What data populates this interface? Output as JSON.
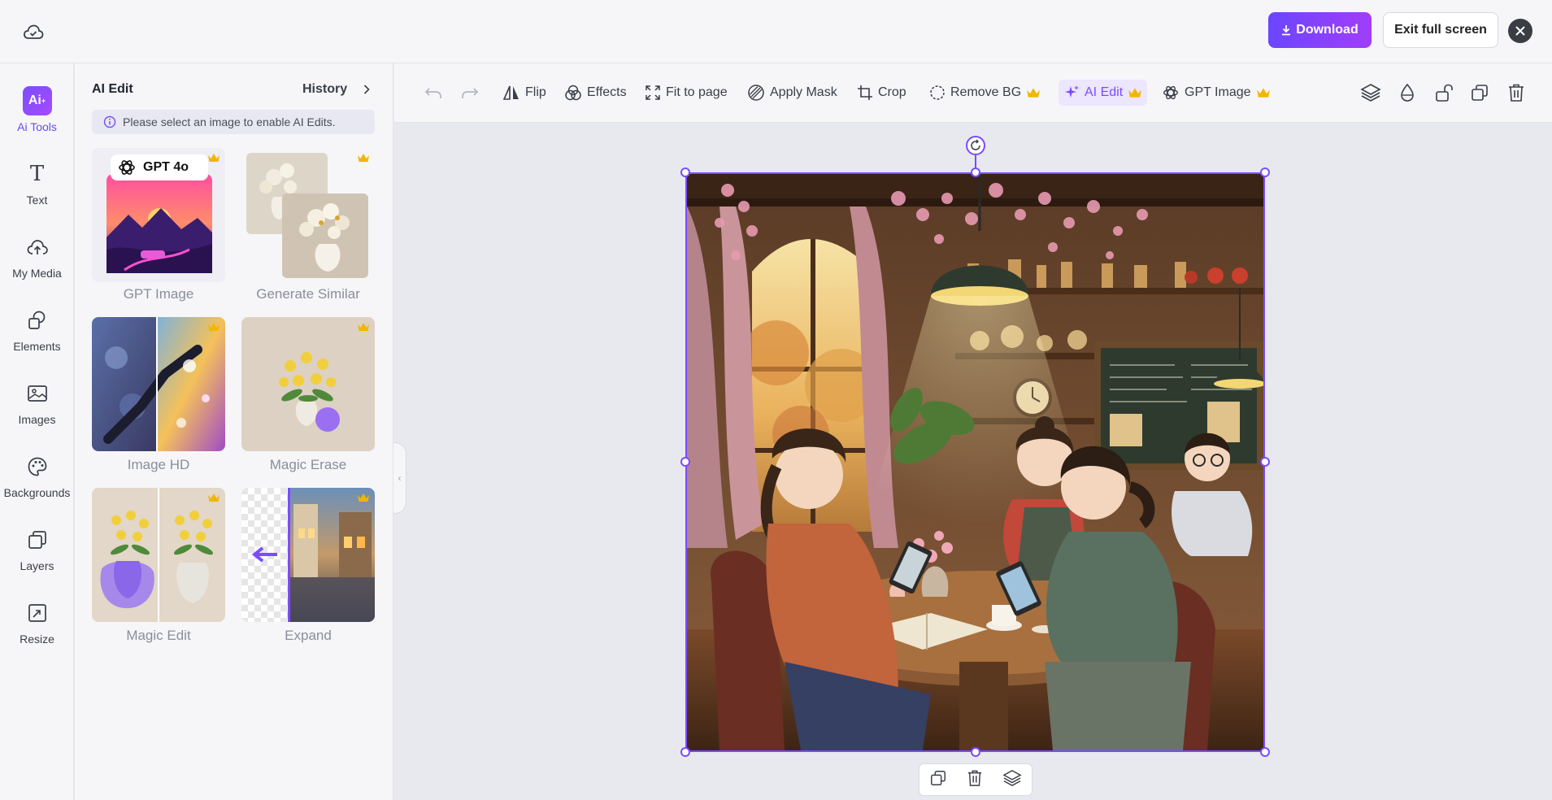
{
  "topbar": {
    "download_label": "Download",
    "exit_label": "Exit full screen"
  },
  "rail": {
    "items": [
      {
        "label": "Ai Tools",
        "icon": "ai-tools-icon"
      },
      {
        "label": "Text",
        "icon": "text-icon"
      },
      {
        "label": "My Media",
        "icon": "upload-cloud-icon"
      },
      {
        "label": "Elements",
        "icon": "elements-icon"
      },
      {
        "label": "Images",
        "icon": "image-icon"
      },
      {
        "label": "Backgrounds",
        "icon": "palette-icon"
      },
      {
        "label": "Layers",
        "icon": "layers-icon"
      },
      {
        "label": "Resize",
        "icon": "resize-icon"
      }
    ]
  },
  "panel": {
    "title": "AI Edit",
    "history_label": "History",
    "notice": "Please select an image to enable AI Edits.",
    "tools": [
      {
        "label": "GPT Image",
        "badge": "GPT 4o"
      },
      {
        "label": "Generate Similar"
      },
      {
        "label": "Image HD"
      },
      {
        "label": "Magic Erase"
      },
      {
        "label": "Magic Edit"
      },
      {
        "label": "Expand"
      }
    ]
  },
  "toolbar": {
    "items": [
      {
        "label": "Flip",
        "icon": "flip-icon"
      },
      {
        "label": "Effects",
        "icon": "effects-icon"
      },
      {
        "label": "Fit to page",
        "icon": "fit-icon"
      },
      {
        "label": "Apply Mask",
        "icon": "mask-icon"
      },
      {
        "label": "Crop",
        "icon": "crop-icon"
      },
      {
        "label": "Remove BG",
        "icon": "remove-bg-icon"
      },
      {
        "label": "AI Edit",
        "icon": "sparkle-icon"
      },
      {
        "label": "GPT Image",
        "icon": "openai-icon"
      }
    ]
  },
  "colors": {
    "accent": "#7a4cff",
    "crown": "#f2b600"
  }
}
